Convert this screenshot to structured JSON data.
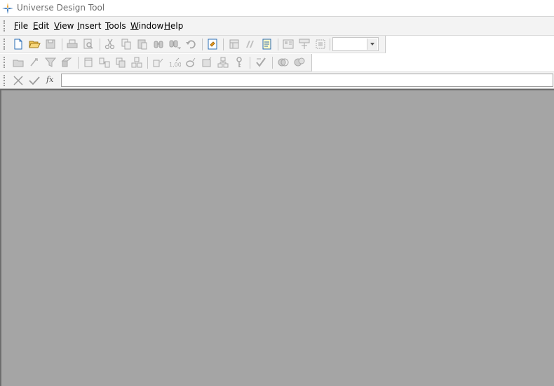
{
  "window": {
    "title": "Universe Design Tool"
  },
  "menu": [
    {
      "id": "file",
      "label": "File"
    },
    {
      "id": "edit",
      "label": "Edit"
    },
    {
      "id": "view",
      "label": "View"
    },
    {
      "id": "insert",
      "label": "Insert"
    },
    {
      "id": "tools",
      "label": "Tools"
    },
    {
      "id": "window",
      "label": "Window"
    },
    {
      "id": "help",
      "label": "Help"
    }
  ],
  "toolbar_standard": [
    {
      "icon": "new-file-icon",
      "enabled": true
    },
    {
      "icon": "open-folder-icon",
      "enabled": true
    },
    {
      "icon": "save-icon",
      "enabled": false
    },
    {
      "icon": "print-icon",
      "enabled": false
    },
    {
      "icon": "print-preview-icon",
      "enabled": false
    },
    {
      "icon": "cut-icon",
      "enabled": false
    },
    {
      "icon": "copy-icon",
      "enabled": false
    },
    {
      "icon": "paste-icon",
      "enabled": false
    },
    {
      "icon": "find-icon",
      "enabled": false
    },
    {
      "icon": "find-next-icon",
      "enabled": false
    },
    {
      "icon": "undo-icon",
      "enabled": false
    },
    {
      "icon": "universe-parameters-icon",
      "enabled": true
    },
    {
      "icon": "table-browser-icon",
      "enabled": false
    },
    {
      "icon": "detect-joins-icon",
      "enabled": false
    },
    {
      "icon": "check-integrity-icon",
      "enabled": true
    },
    {
      "icon": "arrange-tables-icon",
      "enabled": false
    },
    {
      "icon": "list-mode-icon",
      "enabled": false
    },
    {
      "icon": "zoom-icon",
      "enabled": false
    }
  ],
  "zoom_combo": {
    "value": ""
  },
  "toolbar_editing": [
    {
      "icon": "insert-class-icon",
      "enabled": false
    },
    {
      "icon": "insert-object-icon",
      "enabled": false
    },
    {
      "icon": "insert-condition-icon",
      "enabled": false
    },
    {
      "icon": "insert-measure-icon",
      "enabled": false
    },
    {
      "icon": "insert-table-icon",
      "enabled": false
    },
    {
      "icon": "insert-join-icon",
      "enabled": false
    },
    {
      "icon": "insert-alias-icon",
      "enabled": false
    },
    {
      "icon": "insert-derived-table-icon",
      "enabled": false
    },
    {
      "icon": "detect-cardinalities-icon",
      "enabled": false
    },
    {
      "icon": "cardinality-icon",
      "enabled": false
    },
    {
      "icon": "detect-contexts-icon",
      "enabled": false
    },
    {
      "icon": "insert-context-icon",
      "enabled": false
    },
    {
      "icon": "hierarchy-icon",
      "enabled": false
    },
    {
      "icon": "key-icon",
      "enabled": false
    },
    {
      "icon": "check-join-icon",
      "enabled": false
    },
    {
      "icon": "link-universe-icon",
      "enabled": false
    },
    {
      "icon": "include-universe-icon",
      "enabled": false
    }
  ],
  "formula_bar": {
    "fx_label": "fx",
    "value": ""
  },
  "colors": {
    "workspace": "#a5a5a5",
    "toolbar_bg": "#f3f3f3",
    "icon_enabled": "#2a6db5",
    "icon_disabled": "#a8a8a8"
  }
}
